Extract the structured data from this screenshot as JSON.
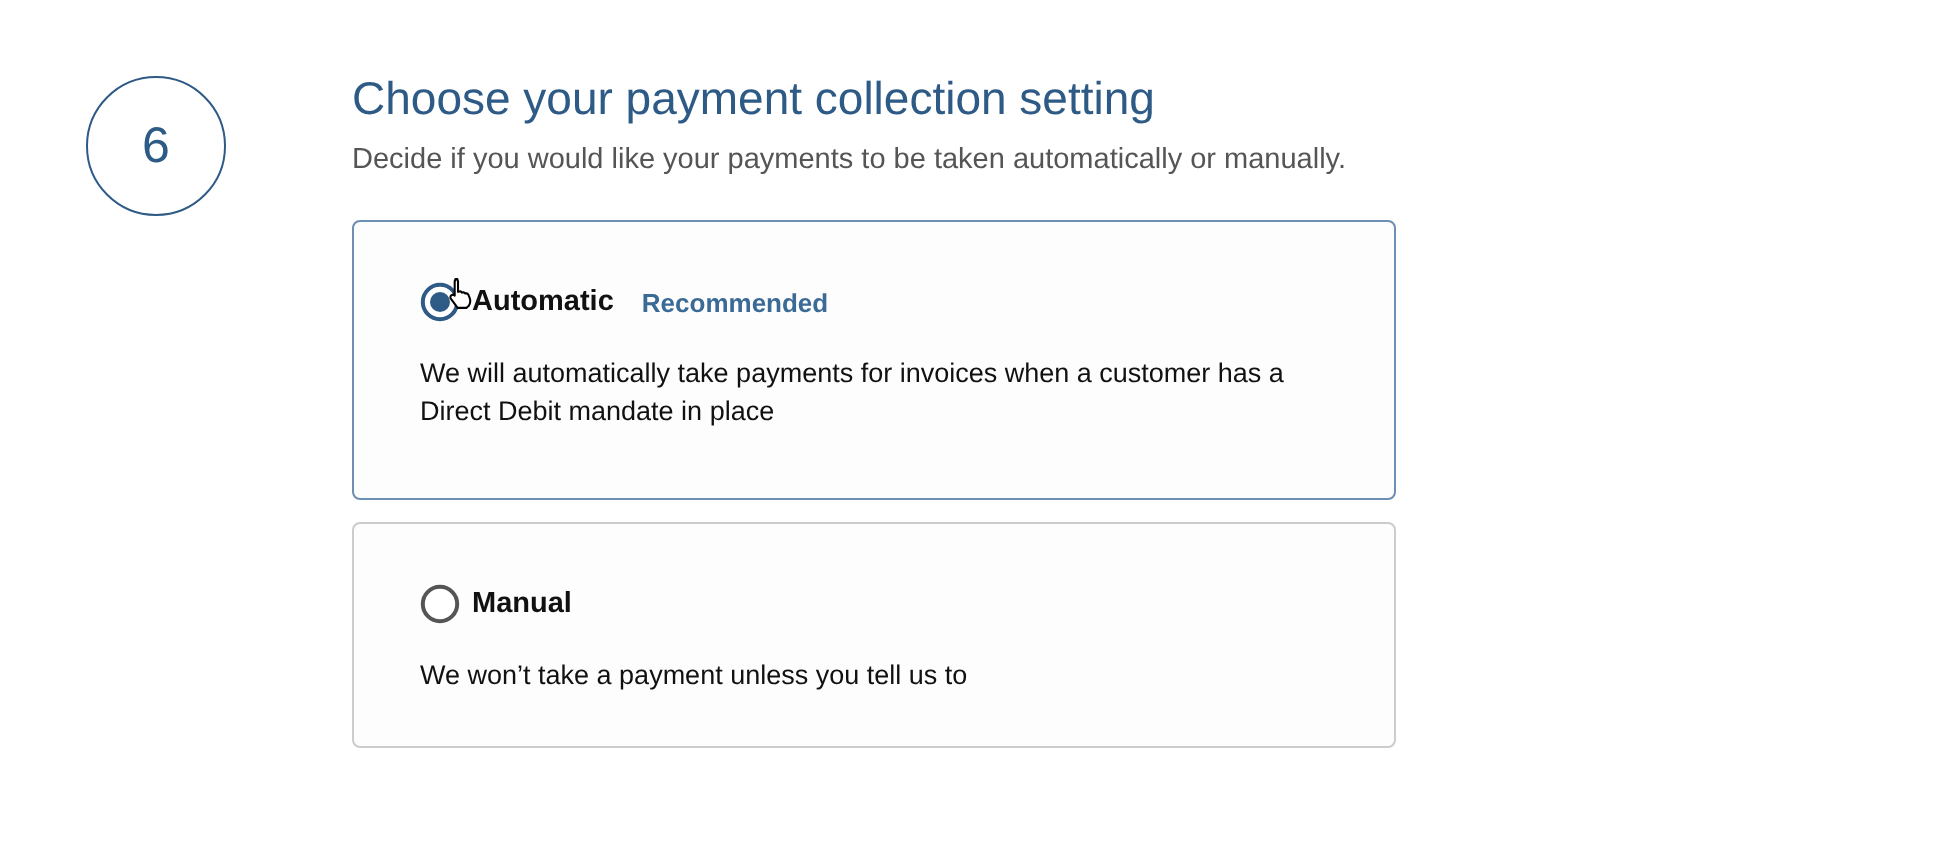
{
  "step": {
    "number": "6"
  },
  "title": "Choose your payment collection setting",
  "subtitle": "Decide if you would like your payments to be taken automatically or manually.",
  "options": [
    {
      "label": "Automatic",
      "tag": "Recommended",
      "description": "We will automatically take payments for invoices when a customer has a Direct Debit mandate in place",
      "selected": true
    },
    {
      "label": "Manual",
      "description": "We won’t take a payment unless you tell us to",
      "selected": false
    }
  ]
}
